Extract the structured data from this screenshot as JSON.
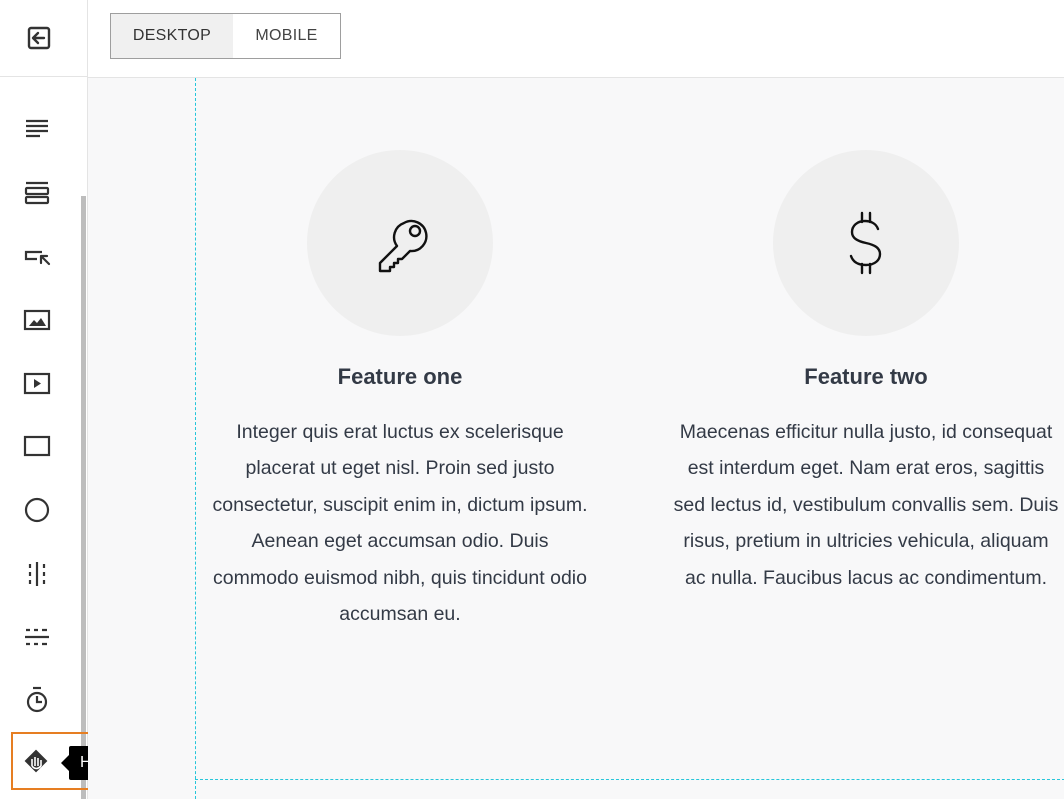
{
  "topbar": {
    "view_toggle": {
      "options": [
        "DESKTOP",
        "MOBILE"
      ],
      "selected": "DESKTOP"
    }
  },
  "sidebar": {
    "exit_icon": "exit-editor-icon",
    "tools": [
      {
        "name": "text",
        "icon": "text-icon"
      },
      {
        "name": "columns",
        "icon": "rows-icon"
      },
      {
        "name": "button",
        "icon": "button-cursor-icon"
      },
      {
        "name": "image",
        "icon": "image-icon"
      },
      {
        "name": "video",
        "icon": "video-icon"
      },
      {
        "name": "rectangle",
        "icon": "rectangle-icon"
      },
      {
        "name": "circle",
        "icon": "circle-icon"
      },
      {
        "name": "divider",
        "icon": "divider-icon"
      },
      {
        "name": "spacer",
        "icon": "spacer-icon"
      },
      {
        "name": "timer",
        "icon": "timer-icon"
      },
      {
        "name": "html",
        "icon": "html-hand-icon"
      }
    ],
    "tooltip": "Html"
  },
  "features": [
    {
      "icon": "key-icon",
      "title": "Feature one",
      "text": "Integer quis erat luctus ex scelerisque placerat ut eget nisl. Proin sed justo consectetur, suscipit enim in, dictum ipsum. Aenean eget accumsan odio. Duis commodo euismod nibh, quis tincidunt odio accumsan eu."
    },
    {
      "icon": "dollar-icon",
      "title": "Feature two",
      "text": "Maecenas efficitur nulla justo, id consequat est interdum eget. Nam erat eros, sagittis sed lectus id, vestibulum convallis sem. Duis risus, pretium in ultricies vehicula, aliquam ac nulla. Faucibus lacus ac condimentum."
    }
  ],
  "colors": {
    "selection_outline": "#e67e22",
    "guide_line": "#26c6da",
    "text": "#333a46",
    "icon_circle": "#efefef"
  }
}
